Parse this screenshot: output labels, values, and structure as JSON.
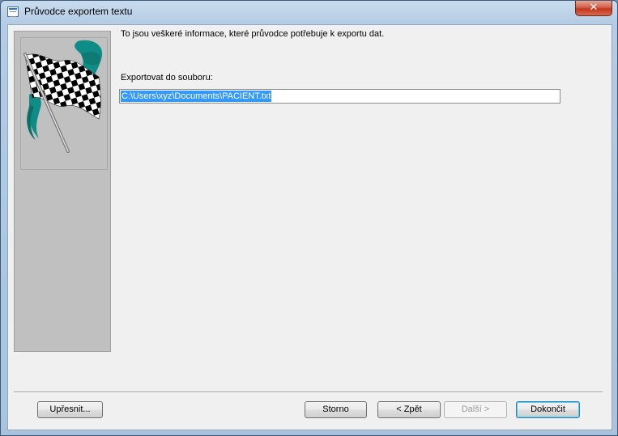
{
  "window": {
    "title": "Průvodce exportem textu",
    "close_label": "✕"
  },
  "content": {
    "intro": "To jsou veškeré informace, které průvodce potřebuje k exportu dat.",
    "export_label": "Exportovat do souboru:",
    "export_path": "C:\\Users\\xyz\\Documents\\PACIENT.txt"
  },
  "buttons": {
    "advanced": "Upřesnit...",
    "cancel": "Storno",
    "back": "< Zpět",
    "next": "Další >",
    "finish": "Dokončit"
  },
  "state": {
    "next_enabled": false,
    "default_button": "finish",
    "path_selected": true
  },
  "colors": {
    "selection": "#3399ff",
    "teal_accent": "#0f8c86",
    "close_red": "#c2371d"
  },
  "icons": {
    "app": "export-wizard-icon",
    "illustration": "checkered-flag-icon"
  }
}
